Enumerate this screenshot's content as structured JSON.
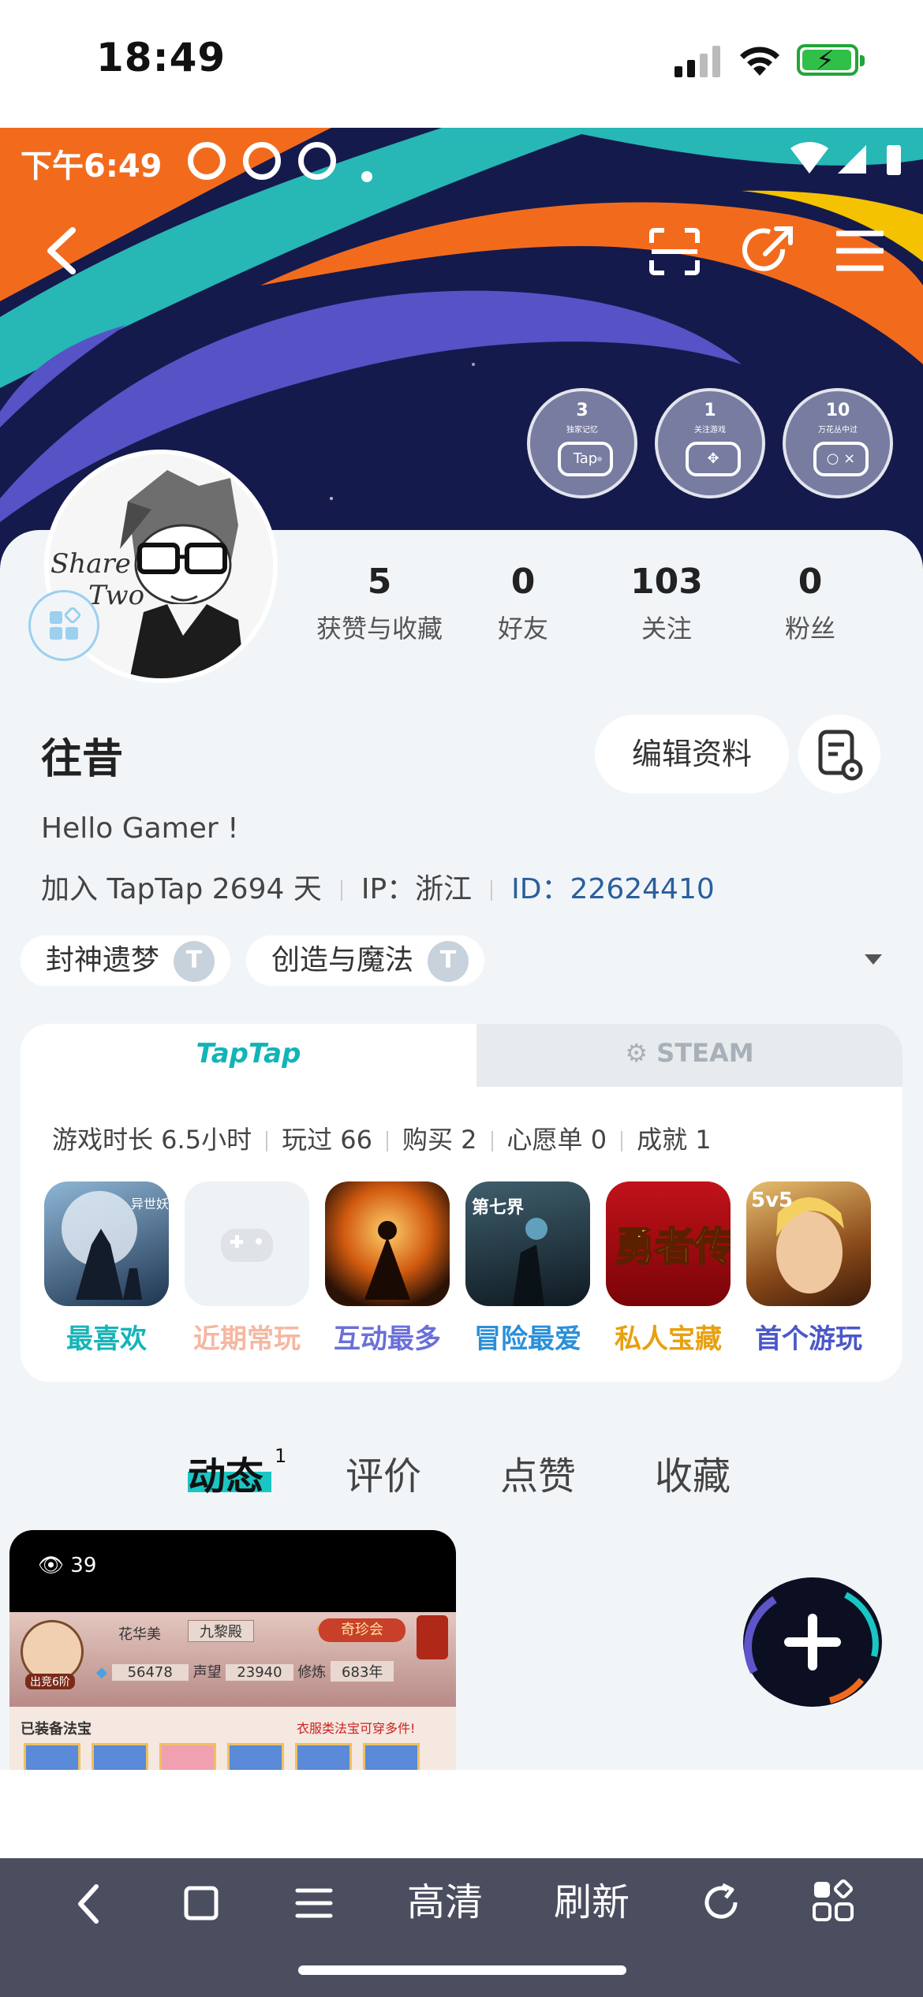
{
  "status_bar": {
    "time": "18:49"
  },
  "android_status": {
    "time": "下午6:49"
  },
  "medals": [
    {
      "count": "3",
      "sub": "独家记忆",
      "glyph": "Tap"
    },
    {
      "count": "1",
      "sub": "关注游戏",
      "glyph": ""
    },
    {
      "count": "10",
      "sub": "万花丛中过",
      "glyph": ""
    }
  ],
  "profile": {
    "avatar_text": "Share Two",
    "stats": [
      {
        "value": "5",
        "label": "获赞与收藏"
      },
      {
        "value": "0",
        "label": "好友"
      },
      {
        "value": "103",
        "label": "关注"
      },
      {
        "value": "0",
        "label": "粉丝"
      }
    ],
    "username": "往昔",
    "edit_label": "编辑资料",
    "bio": "Hello Gamer !",
    "joined": "加入 TapTap 2694 天",
    "ip": "IP：浙江",
    "id_prefix": "ID：",
    "id_value": "22624410"
  },
  "tags": [
    {
      "label": "封神遗梦",
      "badge": "T"
    },
    {
      "label": "创造与魔法",
      "badge": "T"
    }
  ],
  "games_panel": {
    "tab_taptap": "TapTap",
    "tab_steam": "STEAM",
    "stats": [
      "游戏时长 6.5小时",
      "玩过 66",
      "购买 2",
      "心愿单 0",
      "成就 1"
    ],
    "games": [
      {
        "label": "最喜欢",
        "color": "#16b4b8"
      },
      {
        "label": "近期常玩",
        "color": "#f5b7a1"
      },
      {
        "label": "互动最多",
        "color": "#6a6fd8"
      },
      {
        "label": "冒险最爱",
        "color": "#2a8fd8"
      },
      {
        "label": "私人宝藏",
        "color": "#e8a010"
      },
      {
        "label": "首个游玩",
        "color": "#4a58c8"
      }
    ],
    "icon_texts": [
      "异世妖界",
      "",
      "",
      "第七界",
      "勇者传",
      "5v5"
    ]
  },
  "content_tabs": {
    "items": [
      "动态",
      "评价",
      "点赞",
      "收藏"
    ],
    "active_badge": "1"
  },
  "post": {
    "views": "39",
    "game_name": "花华美",
    "server": "九黎殿",
    "event": "奇珍会",
    "coins": "56478",
    "reputation_label": "声望",
    "reputation": "23940",
    "cultivation_label": "修炼",
    "cultivation": "683年",
    "section": "已装备法宝",
    "section_hint": "衣服类法宝可穿多件!",
    "avatar_label": "出竞6阶"
  },
  "browser_bar": {
    "hd_label": "高清",
    "refresh_label": "刷新"
  }
}
